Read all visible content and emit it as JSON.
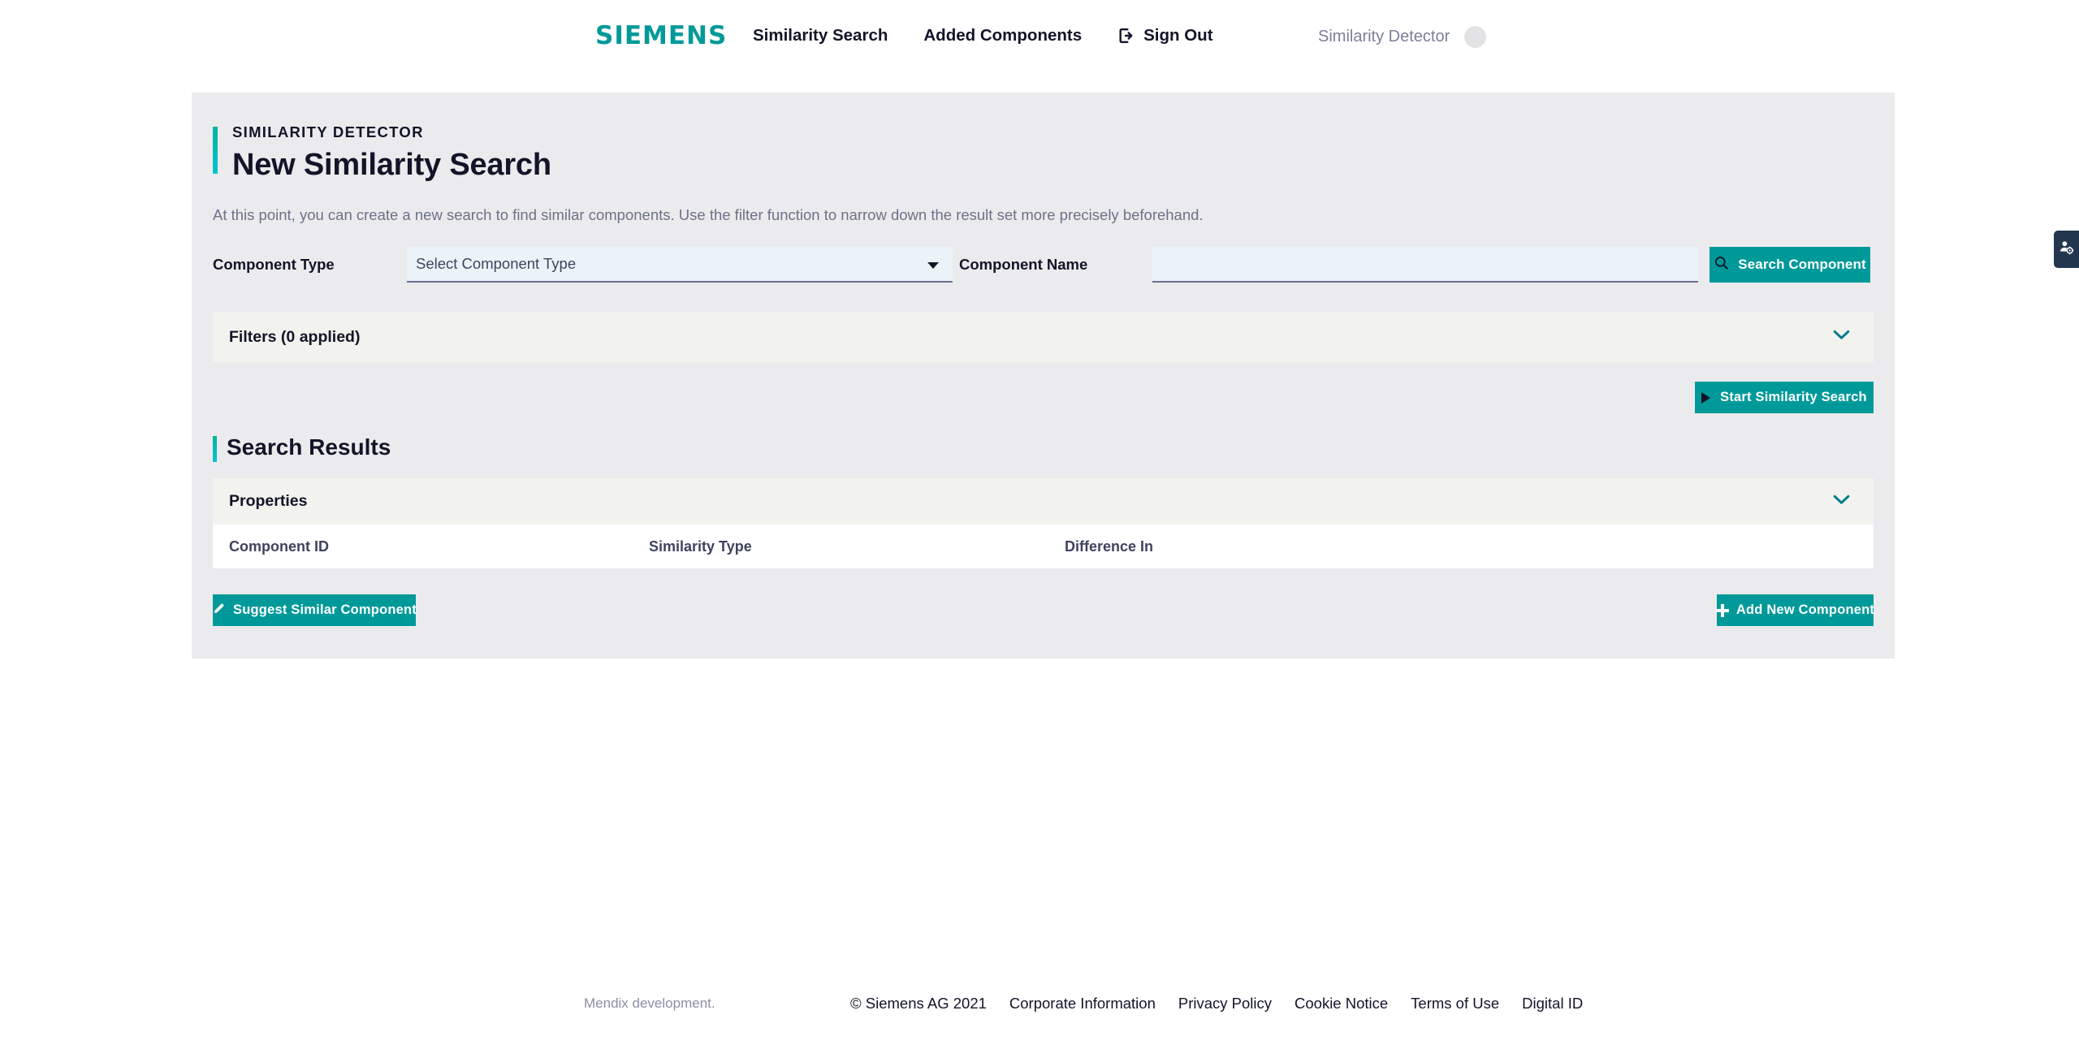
{
  "header": {
    "brand": "SIEMENS",
    "nav": [
      {
        "label": "Similarity Search",
        "name": "nav-similarity-search"
      },
      {
        "label": "Added Components",
        "name": "nav-added-components"
      }
    ],
    "signout_label": "Sign Out",
    "user_name": "Similarity Detector"
  },
  "main": {
    "eyebrow": "SIMILARITY DETECTOR",
    "title": "New Similarity Search",
    "description": "At this point, you can create a new search to find similar components. Use the filter function to narrow down the result set more precisely beforehand.",
    "form": {
      "component_type_label": "Component Type",
      "component_type_value": "Select Component Type",
      "component_name_label": "Component Name",
      "component_name_value": "",
      "component_name_placeholder": "",
      "search_button": "Search Component"
    },
    "filters": {
      "title": "Filters (0 applied)",
      "applied_count": 0,
      "expanded": false
    },
    "start_button": "Start Similarity Search",
    "results": {
      "title": "Search Results",
      "properties_title": "Properties",
      "properties_expanded": false,
      "columns": [
        "Component ID",
        "Similarity Type",
        "Difference In"
      ],
      "rows": []
    },
    "suggest_button": "Suggest Similar Component",
    "add_button": "Add New Component"
  },
  "footer": {
    "dev_note": "Mendix development.",
    "copyright": "© Siemens AG 2021",
    "links": [
      "Corporate Information",
      "Privacy Policy",
      "Cookie Notice",
      "Terms of Use",
      "Digital ID"
    ]
  },
  "colors": {
    "brand_teal": "#009999",
    "accent_gradient_start": "#00b39b",
    "accent_gradient_end": "#00c4d4",
    "panel_bg": "#ebebee",
    "collapse_bg": "#f2f2ee",
    "input_bg": "#eaf4f8",
    "text_dark": "#131428",
    "side_tab_bg": "#22374d"
  }
}
